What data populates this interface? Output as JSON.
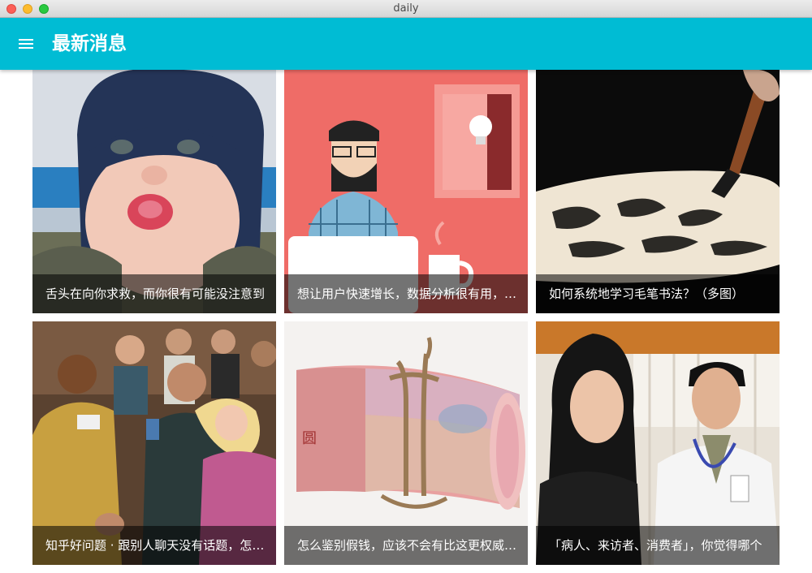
{
  "window": {
    "title": "daily"
  },
  "appbar": {
    "menu_icon": "hamburger-menu-icon",
    "title": "最新消息"
  },
  "cards": [
    {
      "title": "舌头在向你求救，而你很有可能没注意到"
    },
    {
      "title": "想让用户快速增长，数据分析很有用，但是"
    },
    {
      "title": "如何系统地学习毛笔书法？（多图）"
    },
    {
      "title": "知乎好问题 · 跟别人聊天没有话题，怎么办"
    },
    {
      "title": "怎么鉴别假钱，应该不会有比这更权威的了"
    },
    {
      "title": "「病人、来访者、消费者」，你觉得哪个"
    }
  ],
  "colors": {
    "appbar": "#00bcd4",
    "caption_bg": "rgba(0,0,0,0.55)"
  }
}
